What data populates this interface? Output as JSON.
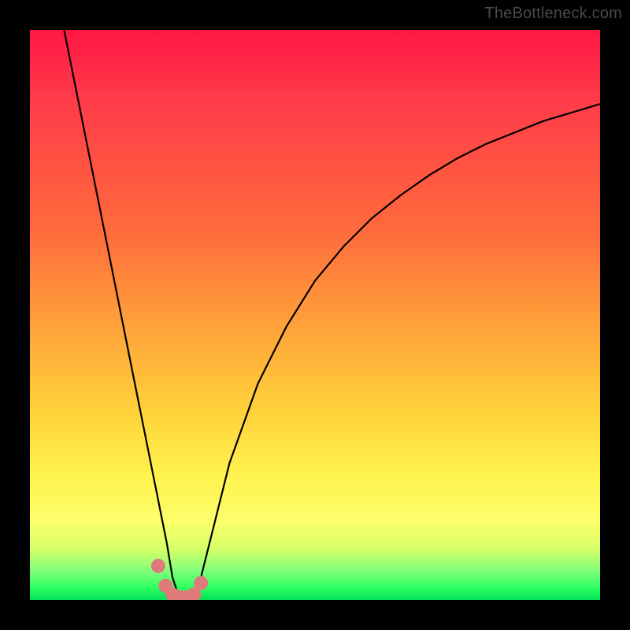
{
  "watermark": {
    "text": "TheBottleneck.com"
  },
  "chart_data": {
    "type": "line",
    "title": "",
    "xlabel": "",
    "ylabel": "",
    "xlim": [
      0,
      100
    ],
    "ylim": [
      0,
      100
    ],
    "grid": false,
    "legend": false,
    "background_gradient": {
      "direction": "vertical",
      "stops": [
        {
          "pos": 0.0,
          "color": "#ff1744",
          "meaning": "high bottleneck"
        },
        {
          "pos": 0.5,
          "color": "#ffa23a"
        },
        {
          "pos": 0.8,
          "color": "#fff24d"
        },
        {
          "pos": 1.0,
          "color": "#00e05a",
          "meaning": "no bottleneck"
        }
      ]
    },
    "series": [
      {
        "name": "bottleneck-curve",
        "stroke": "#000000",
        "stroke_width": 2.2,
        "x": [
          6,
          8,
          10,
          12,
          14,
          16,
          18,
          20,
          22,
          24,
          25,
          26,
          27,
          28,
          29,
          30,
          32,
          35,
          40,
          45,
          50,
          55,
          60,
          65,
          70,
          75,
          80,
          85,
          90,
          95,
          100
        ],
        "values": [
          100,
          90,
          80,
          70,
          60,
          50,
          40,
          30,
          20,
          10,
          4,
          1,
          0,
          0,
          1,
          4,
          12,
          24,
          38,
          48,
          56,
          62,
          67,
          71,
          74.5,
          77.5,
          80,
          82,
          84,
          85.5,
          87
        ]
      }
    ],
    "markers": {
      "name": "valley-markers",
      "color": "#e07a7a",
      "x": [
        22.5,
        23.8,
        25.0,
        26.3,
        27.5,
        28.8,
        30.0
      ],
      "values": [
        6.0,
        2.5,
        1.0,
        0.5,
        0.5,
        1.0,
        3.0
      ],
      "radius_px": 9
    }
  }
}
